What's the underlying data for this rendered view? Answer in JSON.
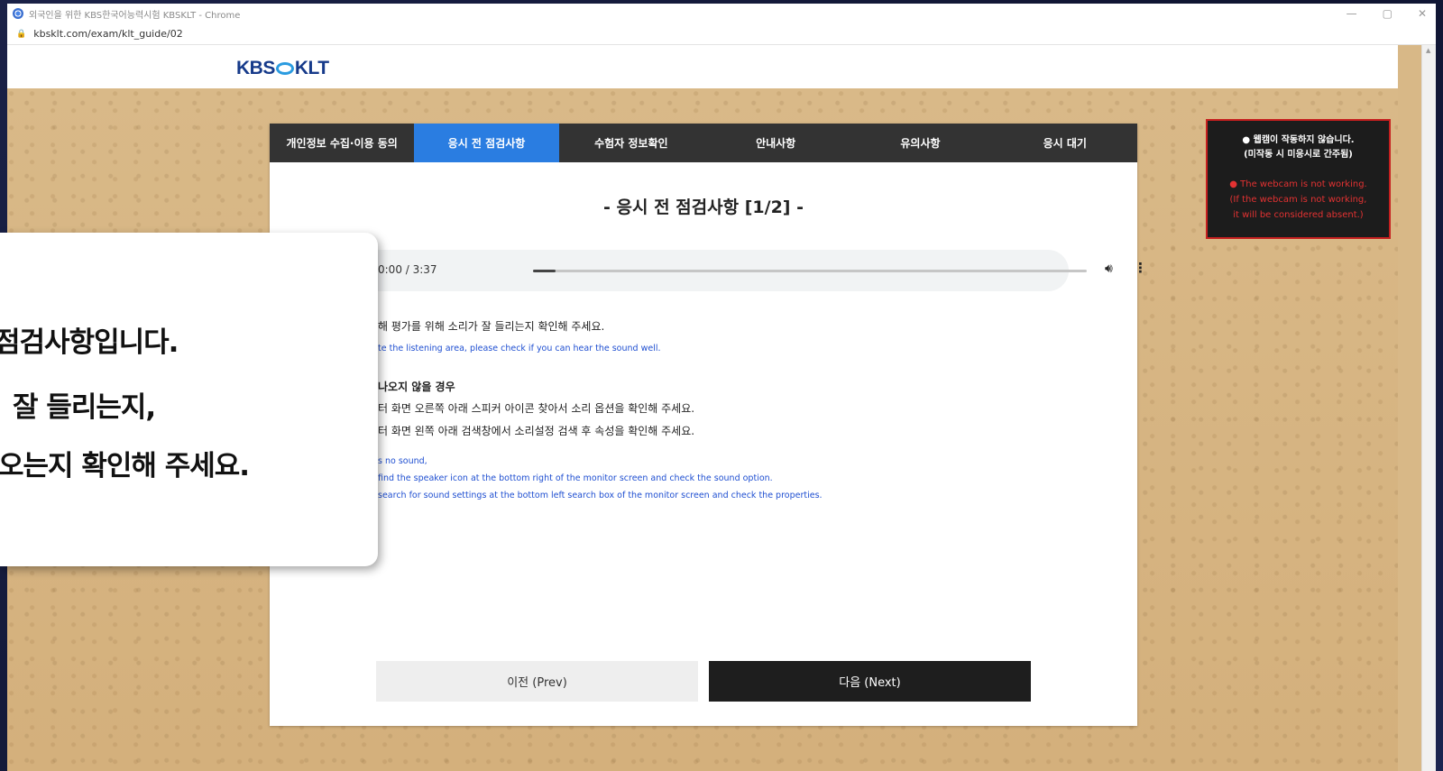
{
  "browser": {
    "window_title": "외국인을 위한 KBS한국어능력시험 KBSKLT - Chrome",
    "url": "kbsklt.com/exam/klt_guide/02",
    "minimize": "—",
    "restore": "▢",
    "close": "✕"
  },
  "header": {
    "logo_left": "KBS",
    "logo_right": "KLT"
  },
  "tabs": [
    {
      "label": "개인정보 수집·이용 동의",
      "active": false
    },
    {
      "label": "응시 전 점검사항",
      "active": true
    },
    {
      "label": "수험자 정보확인",
      "active": false
    },
    {
      "label": "안내사항",
      "active": false
    },
    {
      "label": "유의사항",
      "active": false
    },
    {
      "label": "응시 대기",
      "active": false
    }
  ],
  "panel": {
    "title": "- 응시 전 점검사항 [1/2] -",
    "audio": {
      "time": "0:00 / 3:37",
      "progress": 0.04
    },
    "check_ko": "해 평가를 위해 소리가 잘 들리는지 확인해 주세요.",
    "check_en": "te the listening area, please check if you can hear the sound well.",
    "no_sound_heading": "나오지 않을 경우",
    "no_sound_ko_1": "터 화면 오른쪽 아래 스피커 아이콘 찾아서 소리 옵션을 확인해 주세요.",
    "no_sound_ko_2": "터 화면 왼쪽 아래 검색창에서 소리설정 검색 후 속성을 확인해 주세요.",
    "no_sound_en_heading": "s no sound,",
    "no_sound_en_1": "find the speaker icon at the bottom right of the monitor screen and check the sound option.",
    "no_sound_en_2": "search for sound settings at the bottom left search box of the monitor screen and check the properties."
  },
  "buttons": {
    "prev": "이전 (Prev)",
    "next": "다음 (Next)"
  },
  "webcam_warning": {
    "ko_line1": "● 웹캠이 작동하지 않습니다.",
    "ko_line2": "(미작동 시 미응시로 간주됨)",
    "en_line1": "● The webcam is not working.",
    "en_line2": "(If the webcam is not working,",
    "en_line3": "it will be considered absent.)"
  },
  "overlay": {
    "line1": "점검사항입니다.",
    "line2": "잘 들리는지,",
    "line3": "오는지 확인해 주세요."
  },
  "colors": {
    "tab_bar": "#333333",
    "tab_active": "#2a7de1",
    "english_text": "#1f4fd1",
    "warning_border": "#c61f1f",
    "warning_text": "#e23232",
    "next_button": "#1e1e1e"
  }
}
